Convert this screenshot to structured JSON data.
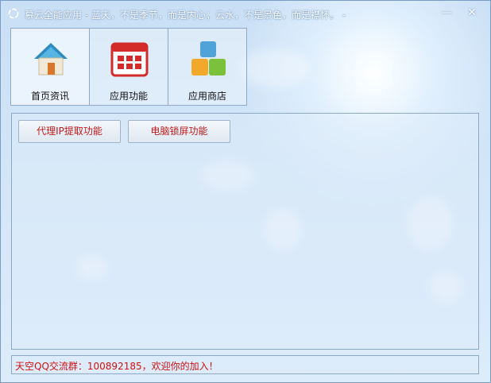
{
  "window": {
    "title": "慕云全能应用 - 蓝天，不是季节，而是内心；云水，不是景色，而是襟怀。 -",
    "minimize_glyph": "—",
    "close_glyph": "✕"
  },
  "tabs": [
    {
      "label": "首页资讯",
      "icon": "home-icon"
    },
    {
      "label": "应用功能",
      "icon": "calendar-grid-icon"
    },
    {
      "label": "应用商店",
      "icon": "blocks-icon"
    }
  ],
  "panel": {
    "buttons": [
      {
        "label": "代理IP提取功能"
      },
      {
        "label": "电脑锁屏功能"
      }
    ]
  },
  "status": {
    "text": "天空QQ交流群：100892185，欢迎你的加入！"
  },
  "colors": {
    "accent_red": "#c11a1a",
    "border": "#8ea8c7",
    "sky": "#d3e6f8"
  }
}
